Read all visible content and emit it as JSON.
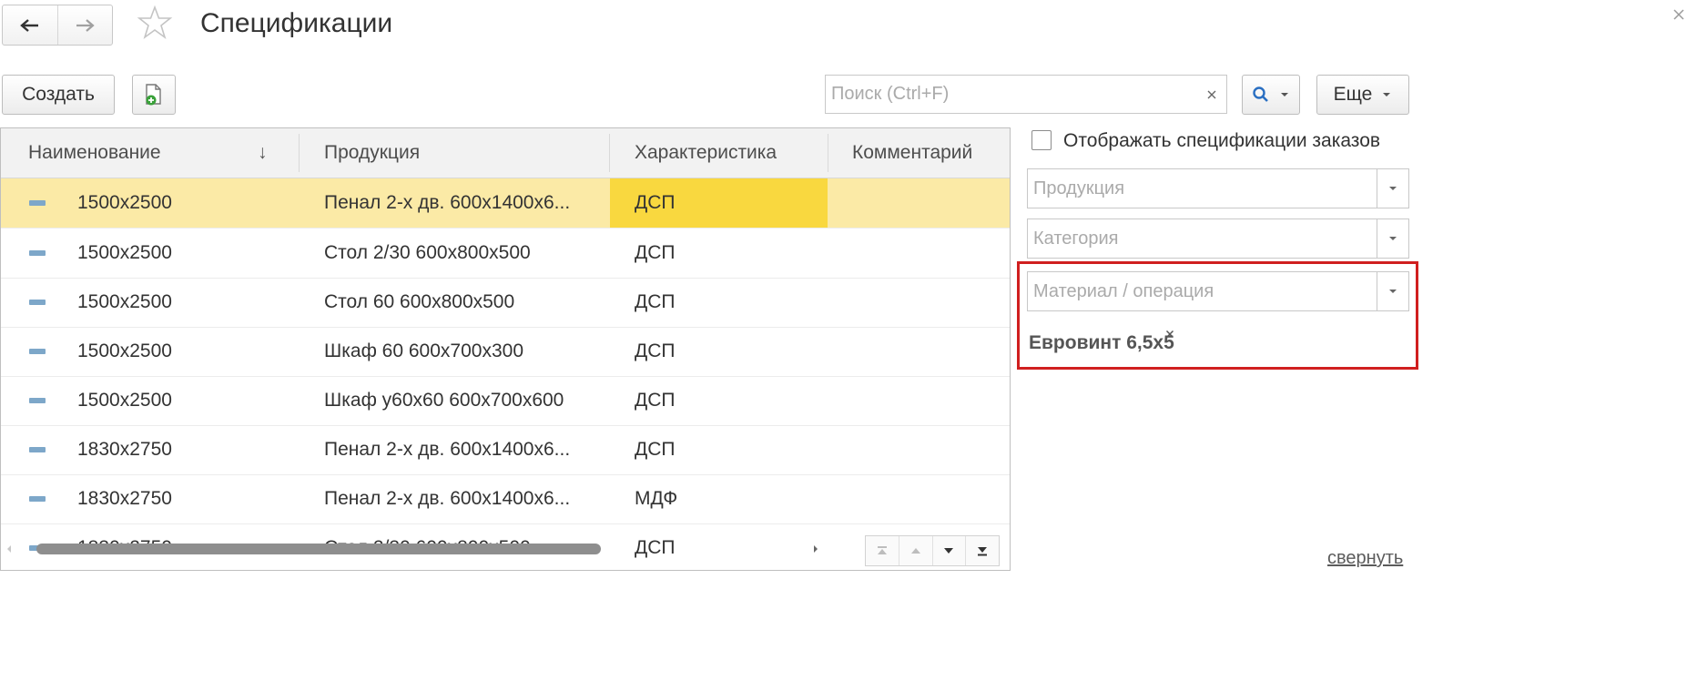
{
  "header": {
    "title": "Спецификации",
    "back_icon": "arrow-left-icon",
    "forward_icon": "arrow-right-icon",
    "favorite_icon": "star-icon",
    "close_icon": "close-icon"
  },
  "toolbar": {
    "create_label": "Создать",
    "add_file_icon": "document-add-icon",
    "search_placeholder": "Поиск (Ctrl+F)",
    "search_clear_icon": "close-icon",
    "search_icon": "search-icon",
    "more_label": "Еще"
  },
  "table": {
    "columns": [
      "Наименование",
      "Продукция",
      "Характеристика",
      "Комментарий"
    ],
    "sort_indicator": "↓",
    "rows": [
      {
        "name": "1500x2500",
        "product": "Пенал 2-х дв. 600х1400х6...",
        "characteristic": "ДСП",
        "comment": "",
        "selected": true
      },
      {
        "name": "1500x2500",
        "product": "Стол 2/30 600х800х500",
        "characteristic": "ДСП",
        "comment": ""
      },
      {
        "name": "1500x2500",
        "product": "Стол 60 600х800х500",
        "characteristic": "ДСП",
        "comment": ""
      },
      {
        "name": "1500x2500",
        "product": "Шкаф 60 600х700х300",
        "characteristic": "ДСП",
        "comment": ""
      },
      {
        "name": "1500x2500",
        "product": "Шкаф у60х60 600х700х600",
        "characteristic": "ДСП",
        "comment": ""
      },
      {
        "name": "1830x2750",
        "product": "Пенал 2-х дв. 600х1400х6...",
        "characteristic": "ДСП",
        "comment": ""
      },
      {
        "name": "1830x2750",
        "product": "Пенал 2-х дв. 600х1400х6...",
        "characteristic": "МДФ",
        "comment": ""
      },
      {
        "name": "1830x2750",
        "product": "Стол 2/30 600х800х500",
        "characteristic": "ДСП",
        "comment": ""
      }
    ]
  },
  "filters": {
    "show_order_specs_label": "Отображать спецификации заказов",
    "show_order_specs_checked": false,
    "product_placeholder": "Продукция",
    "category_placeholder": "Категория",
    "material_placeholder": "Материал / операция",
    "selected_material": "Евровинт 6,5х5",
    "remove_icon": "close-icon"
  },
  "footer": {
    "collapse_label": "свернуть"
  },
  "colors": {
    "selected_row": "#fbeaa6",
    "selected_cell": "#f9d83f",
    "highlight_border": "#d01f1f",
    "row_marker": "#7da7c9"
  }
}
